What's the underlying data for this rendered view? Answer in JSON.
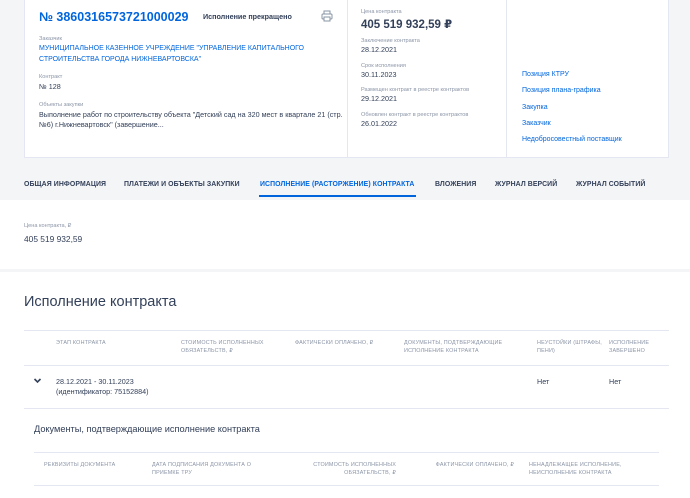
{
  "contract": {
    "reg_number": "№ 3860316573721000029",
    "status": "Исполнение прекращено",
    "customer_label": "Заказчик",
    "customer_name": "МУНИЦИПАЛЬНОЕ КАЗЕННОЕ УЧРЕЖДЕНИЕ \"УПРАВЛЕНИЕ КАПИТАЛЬНОГО СТРОИТЕЛЬСТВА ГОРОДА НИЖНЕВАРТОВСКА\"",
    "contract_label": "Контракт",
    "contract_value": "№ 128",
    "objects_label": "Объекты закупки",
    "objects_value": "Выполнение работ по строительству объекта \"Детский сад на 320 мест в квартале 21 (стр. №6) г.Нижневартовск\" (завершение..."
  },
  "details": {
    "price_label": "Цена контракта",
    "price_value": "405 519 932,59 ₽",
    "conclusion_label": "Заключение контракта",
    "conclusion_value": "28.12.2021",
    "term_label": "Срок исполнения",
    "term_value": "30.11.2023",
    "placed_label": "Размещен контракт в реестре контрактов",
    "placed_value": "29.12.2021",
    "updated_label": "Обновлен контракт в реестре контрактов",
    "updated_value": "26.01.2022"
  },
  "side_links": [
    "Позиция КТРУ",
    "Позиция плана-графика",
    "Закупка",
    "Заказчик",
    "Недобросовестный поставщик"
  ],
  "tabs": [
    "ОБЩАЯ ИНФОРМАЦИЯ",
    "ПЛАТЕЖИ И ОБЪЕКТЫ ЗАКУПКИ",
    "ИСПОЛНЕНИЕ (РАСТОРЖЕНИЕ) КОНТРАКТА",
    "ВЛОЖЕНИЯ",
    "ЖУРНАЛ ВЕРСИЙ",
    "ЖУРНАЛ СОБЫТИЙ"
  ],
  "active_tab": "ИСПОЛНЕНИЕ (РАСТОРЖЕНИЕ) КОНТРАКТА",
  "price_section": {
    "label": "Цена контракта, ₽",
    "value": "405 519 932,59"
  },
  "execution": {
    "title": "Исполнение контракта",
    "columns": [
      "ЭТАП КОНТРАКТА",
      "СТОИМОСТЬ ИСПОЛНЕННЫХ ОБЯЗАТЕЛЬСТВ, ₽",
      "ФАКТИЧЕСКИ ОПЛАЧЕНО, ₽",
      "ДОКУМЕНТЫ, ПОДТВЕРЖДАЮЩИЕ ИСПОЛНЕНИЕ КОНТРАКТА",
      "НЕУСТОЙКИ (ШТРАФЫ, ПЕНИ)",
      "ИСПОЛНЕНИЕ ЗАВЕРШЕНО"
    ],
    "row": {
      "period": "28.12.2021 - 30.11.2023",
      "identifier": "(идентификатор: 75152884)",
      "penalties": "Нет",
      "completed": "Нет"
    }
  },
  "documents": {
    "title": "Документы, подтверждающие исполнение контракта",
    "columns": [
      "РЕКВИЗИТЫ ДОКУМЕНТА",
      "ДАТА ПОДПИСАНИЯ ДОКУМЕНТА О ПРИЕМКЕ ТРУ",
      "СТОИМОСТЬ ИСПОЛНЕННЫХ ОБЯЗАТЕЛЬСТВ, ₽",
      "ФАКТИЧЕСКИ ОПЛАЧЕНО, ₽",
      "НЕНАДЛЕЖАЩЕЕ ИСПОЛНЕНИЕ, НЕИСПОЛНЕНИЕ КОНТРАКТА"
    ]
  },
  "colors": {
    "accent": "#0065dd",
    "text": "#334059",
    "muted": "#8a94a6",
    "border": "#e4e7f2",
    "background": "#f4f5f7"
  },
  "icons": {
    "print": "printer-icon",
    "expand": "chevron-down-icon"
  }
}
